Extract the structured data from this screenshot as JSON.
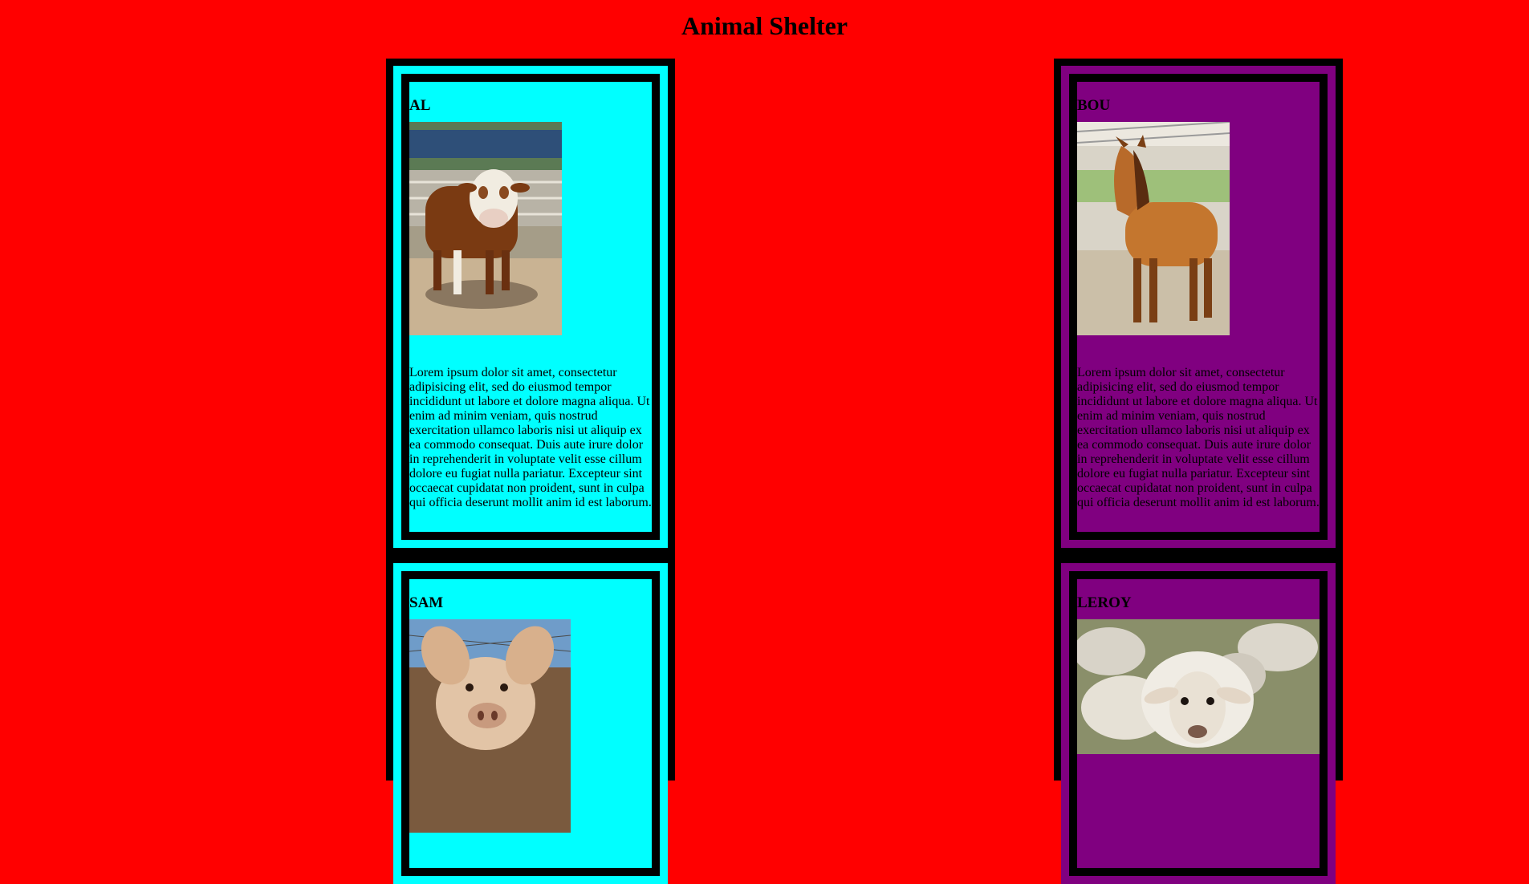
{
  "page": {
    "title": "Animal Shelter"
  },
  "animals": [
    {
      "name": "AL",
      "description": "Lorem ipsum dolor sit amet, consectetur adipisicing elit, sed do eiusmod tempor incididunt ut labore et dolore magna aliqua. Ut enim ad minim veniam, quis nostrud exercitation ullamco laboris nisi ut aliquip ex ea commodo consequat. Duis aute irure dolor in reprehenderit in voluptate velit esse cillum dolore eu fugiat nulla pariatur. Excepteur sint occaecat cupidatat non proident, sunt in culpa qui officia deserunt mollit anim id est laborum."
    },
    {
      "name": "BOU",
      "description": "Lorem ipsum dolor sit amet, consectetur adipisicing elit, sed do eiusmod tempor incididunt ut labore et dolore magna aliqua. Ut enim ad minim veniam, quis nostrud exercitation ullamco laboris nisi ut aliquip ex ea commodo consequat. Duis aute irure dolor in reprehenderit in voluptate velit esse cillum dolore eu fugiat nulla pariatur. Excepteur sint occaecat cupidatat non proident, sunt in culpa qui officia deserunt mollit anim id est laborum."
    },
    {
      "name": "SAM"
    },
    {
      "name": "LEROY"
    }
  ],
  "colors": {
    "page_background": "#ff0000",
    "left_card": "#00ffff",
    "right_card": "#800080",
    "border": "#000000"
  }
}
